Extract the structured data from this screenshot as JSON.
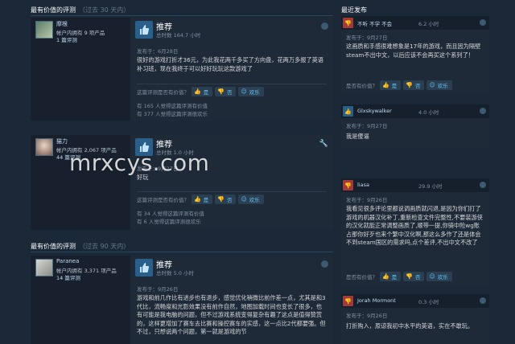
{
  "left": {
    "section1": {
      "title": "最有价值的评测",
      "subtitle": "（过去 30 天内）"
    },
    "section2": {
      "title": "最有价值的评测",
      "subtitle": "（过去 90 天内）"
    },
    "reviews": [
      {
        "user": "摩根",
        "owned": "帐户内拥有 9 项产品",
        "review_count": "1 篇评测",
        "verdict": "推荐",
        "hours": "总时数 164.7 小时",
        "date": "发布于：6月28日",
        "text": "很好的游戏打折才36元，为此我花两千多买了方向盘，花两万多报了英语补习班，现在我终于可以好好玩玩这款游戏了",
        "helpful_q": "这篇评测是否有价值？",
        "yes": "是",
        "no": "否",
        "funny": "欢乐",
        "stat1": "有 165 人觉得这篇评测有价值",
        "stat2": "有 377 人觉得这篇评测很欢乐"
      },
      {
        "user": "猫力",
        "owned": "帐户内拥有 2,067 项产品",
        "review_count": "44 篇评测",
        "verdict": "推荐",
        "hours": "总时数 1.0 小时",
        "date": "发布于：9月27日",
        "text": "好玩",
        "helpful_q": "这篇评测是否有价值？",
        "yes": "是",
        "no": "否",
        "funny": "欢乐",
        "stat1": "有 34 人觉得这篇评测有价值",
        "stat2": "有 6 人觉得这篇评测很欢乐"
      },
      {
        "user": "Paranea",
        "owned": "帐户内拥有 3,371 项产品",
        "review_count": "14 篇评测",
        "verdict": "推荐",
        "hours": "总时数 5.0 小时",
        "date": "发布于：9月26日",
        "text": "游戏和前几作比有进步也有退步，感觉优化稍微比前作差一点，尤其是和3代比，流畅度和光影效果没有前作自然，地图加载时间也变长了很多，也有可能是我电脑的问题，但不过游戏系统变得复杂有趣了这点是值得赞赏的，这样更增加了赛车去比赛和操控赛车的实感，这一点比2代都要强。但不过，只想说两个问题，第一就是游戏的节"
      }
    ]
  },
  "right": {
    "title": "最近发布",
    "reviews": [
      {
        "thumb": "down",
        "user": "不听 不学 不会",
        "hours": "6.2 小时",
        "date": "发布于：9月27日",
        "text": "这画质和手感很难想象是17年的游戏，而且因为隔壁steam不出中文，以后应该不会再买这个系列了！",
        "helpful_q": "是否有价值？",
        "yes": "是",
        "no": "否",
        "funny": "欢乐"
      },
      {
        "thumb": "up",
        "user": "Glxskywalker",
        "hours": "4.0 小时",
        "date": "发布于：9月27日",
        "text": "我是傻逼"
      },
      {
        "thumb": "down",
        "user": "liasa",
        "hours": "29.9 小时",
        "date": "发布于：9月26日",
        "text": "我看见很多评论里都说调画质就闪退,是因为你们打了游戏的机器汉化补丁,重新检查文件完整性,不要装游侠的汉化就能正常调整画质了,顺带一提,你骑中险wg账占那你好歹也来个繁中汉化啊,那这么多作了还是体会不到steam国区的需求吗,点个差评,不出中文不改了",
        "helpful_q": "是否有价值？",
        "yes": "是",
        "no": "否",
        "funny": "欢乐"
      },
      {
        "thumb": "down",
        "user": "Jorah Mormont",
        "hours": "0.3 小时",
        "date": "发布于：9月26日",
        "text": "打折购入，原谅我初中水平的英语，实在不敢玩。"
      }
    ]
  },
  "watermark": "mrxcys.com",
  "colors": {
    "bg": "#1b2838",
    "accent": "#67c1f5",
    "recommend": "#2a5f8a",
    "not_recommend": "#a33a3a"
  }
}
